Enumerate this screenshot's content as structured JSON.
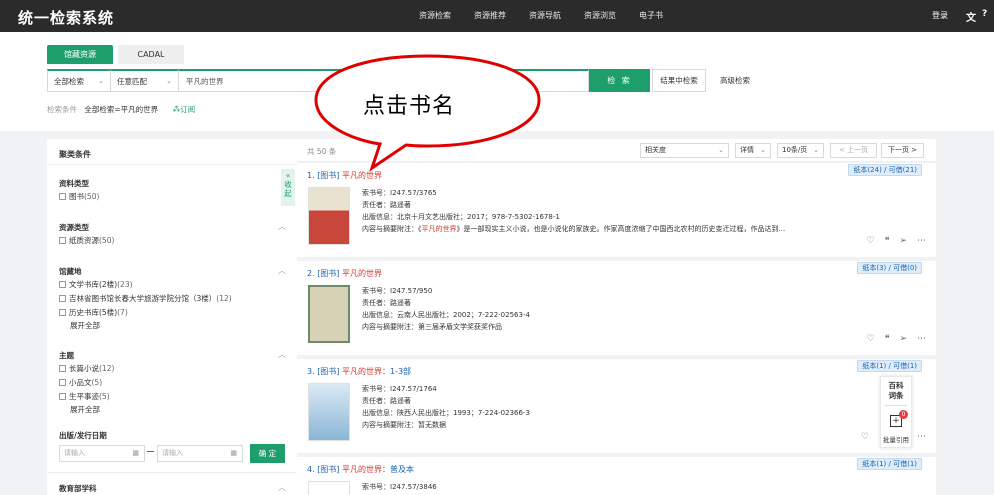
{
  "header": {
    "logo": "统一检索系统",
    "nav": [
      "资源检索",
      "资源推荐",
      "资源导航",
      "资源浏览",
      "电子书"
    ],
    "login": "登录",
    "lang_icon": "文",
    "help_icon": "?"
  },
  "search": {
    "tabs": [
      "馆藏资源",
      "CADAL"
    ],
    "field_select": "全部检索",
    "match_select": "任意匹配",
    "query": "平凡的世界",
    "search_button": "检 索",
    "within_button": "结果中检索",
    "advanced": "高级检索",
    "conditions_label": "检索条件",
    "conditions_value": "全部检索=平凡的世界",
    "subscribe": "订阅"
  },
  "annotation": {
    "text": "点击书名"
  },
  "sidebar": {
    "title": "聚类条件",
    "collapse": [
      "«",
      "收",
      "起"
    ],
    "facets": [
      {
        "title": "资料类型",
        "items": [
          {
            "label": "图书",
            "count": "(50)"
          }
        ]
      },
      {
        "title": "资源类型",
        "items": [
          {
            "label": "纸质资源",
            "count": "(50)"
          }
        ]
      },
      {
        "title": "馆藏地",
        "items": [
          {
            "label": "文学书库(2楼)",
            "count": "(23)"
          },
          {
            "label": "吉林省图书馆长春大学旅游学院分馆（3楼）",
            "count": "(12)"
          },
          {
            "label": "历史书库(5楼)",
            "count": "(7)"
          }
        ],
        "more": "展开全部"
      },
      {
        "title": "主题",
        "items": [
          {
            "label": "长篇小说",
            "count": "(12)"
          },
          {
            "label": "小品文",
            "count": "(5)"
          },
          {
            "label": "生平事迹",
            "count": "(5)"
          }
        ],
        "more": "展开全部"
      }
    ],
    "date": {
      "title": "出版/发行日期",
      "from_placeholder": "请输入",
      "to_placeholder": "请输入",
      "ok": "确 定"
    },
    "next_facet": "教育部学科"
  },
  "results": {
    "total": "共 50 条",
    "sort": "相关度",
    "view": "详情",
    "per_page": "10条/页",
    "prev": "< 上一页",
    "next": "下一页 >",
    "records": [
      {
        "index": "1.",
        "type": "[图书]",
        "title": "平凡的世界",
        "title_suffix": "",
        "call_no": "索书号：I247.57/3765",
        "author": "责任者：路遥著",
        "pub": "出版信息：北京十月文艺出版社；2017；978-7-5302-1678-1",
        "summary_pre": "内容与摘要附注：《",
        "summary_hl": "平凡的世界",
        "summary_post": "》是一部现实主义小说，也是小说化的家族史。作家高度浓缩了中国西北农村的历史变迁过程，作品达到...",
        "badge": "纸本(24) / 可借(21)",
        "cover_colors": [
          "#c8463a",
          "#e9e2cf"
        ]
      },
      {
        "index": "2.",
        "type": "[图书]",
        "title": "平凡的世界",
        "title_suffix": "",
        "call_no": "索书号：I247.57/950",
        "author": "责任者：路遥著",
        "pub": "出版信息：云南人民出版社；2002；7-222-02563-4",
        "summary_pre": "内容与摘要附注：第三届矛盾文学奖获奖作品",
        "summary_hl": "",
        "summary_post": "",
        "badge": "纸本(3) / 可借(0)",
        "cover_colors": [
          "#6f8a6a",
          "#d6d2b5"
        ]
      },
      {
        "index": "3.",
        "type": "[图书]",
        "title": "平凡的世界",
        "title_suffix": "：1-3部",
        "call_no": "索书号：I247.57/1764",
        "author": "责任者：路遥著",
        "pub": "出版信息：陕西人民出版社；1993；7-224-02366-3",
        "summary_pre": "内容与摘要附注：暂无数据",
        "summary_hl": "",
        "summary_post": "",
        "badge": "纸本(1) / 可借(1)",
        "cover_colors": [
          "#8ab6d6",
          "#dbe9f4"
        ]
      },
      {
        "index": "4.",
        "type": "[图书]",
        "title": "平凡的世界",
        "title_suffix": "：普及本",
        "call_no": "索书号：I247.57/3846",
        "author": "",
        "pub": "",
        "summary_pre": "",
        "summary_hl": "",
        "summary_post": "",
        "badge": "纸本(1) / 可借(1)",
        "cover_colors": [
          "#cfcfcf",
          "#eeeeee"
        ]
      }
    ]
  },
  "float_panel": {
    "baike": [
      "百科",
      "词条"
    ],
    "badge_count": "0",
    "batch": "批量引用"
  },
  "icons": [
    "heart-icon",
    "quote-icon",
    "share-icon",
    "more-icon",
    "calendar-icon",
    "chevron-up-icon",
    "chevron-down-icon"
  ],
  "colors": {
    "accent": "#1e9e6b",
    "link": "#1b64b0",
    "highlight": "#d9362b",
    "header_bg": "#2b2b2b"
  }
}
